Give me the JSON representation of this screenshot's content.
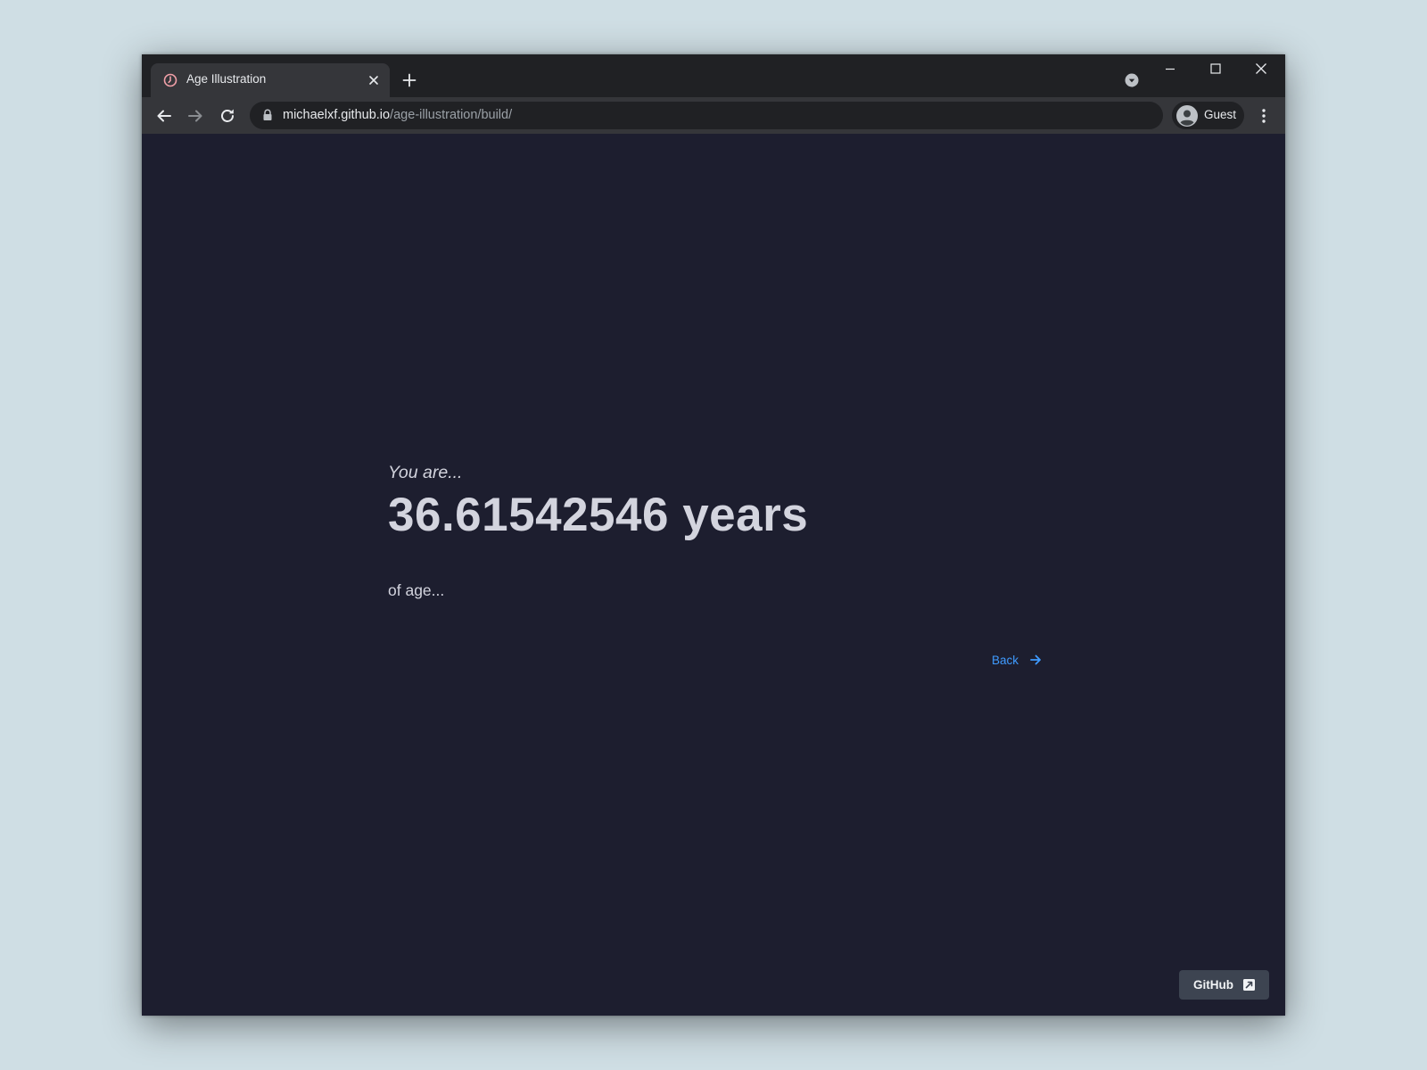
{
  "browser": {
    "tab": {
      "title": "Age Illustration",
      "favicon": "clock-icon"
    },
    "address_bar": {
      "host": "michaelxf.github.io",
      "path": "/age-illustration/build/"
    },
    "profile": {
      "name": "Guest"
    }
  },
  "page": {
    "intro": "You are...",
    "age_value": "36.61542546 years",
    "outro": "of age...",
    "back_link": "Back",
    "github_button": "GitHub"
  },
  "colors": {
    "page_background": "#1d1e2f",
    "text": "#d3d4de",
    "link": "#3f9bff",
    "button_background": "#3d4451"
  }
}
